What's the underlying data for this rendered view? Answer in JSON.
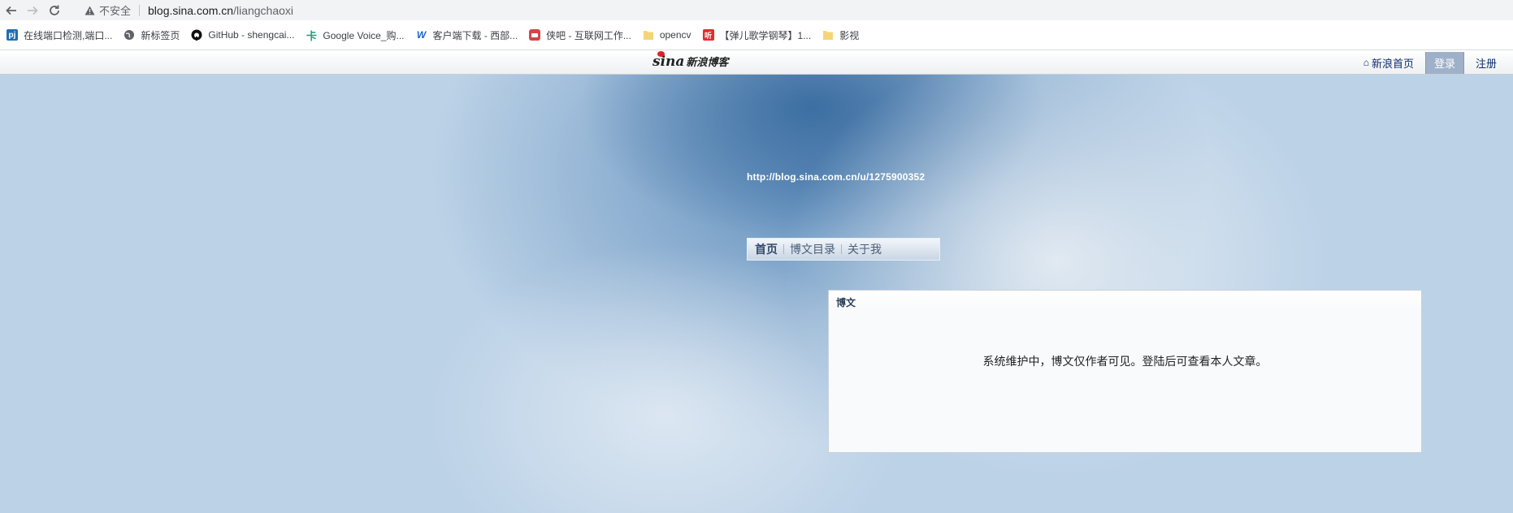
{
  "browser": {
    "url_warning": "不安全",
    "url_host": "blog.sina.com.cn",
    "url_path": "/liangchaoxi"
  },
  "bookmarks": [
    {
      "label": "在线端口检测,端口...",
      "icon": "pj-icon"
    },
    {
      "label": "新标签页",
      "icon": "globe-icon"
    },
    {
      "label": "GitHub - shengcai...",
      "icon": "github-icon"
    },
    {
      "label": "Google Voice_购...",
      "icon": "card-icon"
    },
    {
      "label": "客户端下载 - 西部...",
      "icon": "w-icon"
    },
    {
      "label": "侠吧 - 互联网工作...",
      "icon": "xiaba-icon"
    },
    {
      "label": "opencv",
      "icon": "folder-icon"
    },
    {
      "label": "【弹儿歌学钢琴】1...",
      "icon": "bilibili-icon"
    },
    {
      "label": "影视",
      "icon": "folder-icon"
    }
  ],
  "sina_bar": {
    "logo_word": "sina",
    "logo_cn": "新浪博客",
    "home_link": "新浪首页",
    "login": "登录",
    "register": "注册"
  },
  "blog": {
    "url": "http://blog.sina.com.cn/u/1275900352",
    "nav": [
      "首页",
      "博文目录",
      "关于我"
    ],
    "panel_title": "博文",
    "panel_message": "系统维护中，博文仅作者可见。登陆后可查看本人文章。"
  },
  "colors": {
    "sky": "#bcd2e7",
    "nav_text": "#0d2c6b",
    "login_bg": "#9fb1c9"
  }
}
